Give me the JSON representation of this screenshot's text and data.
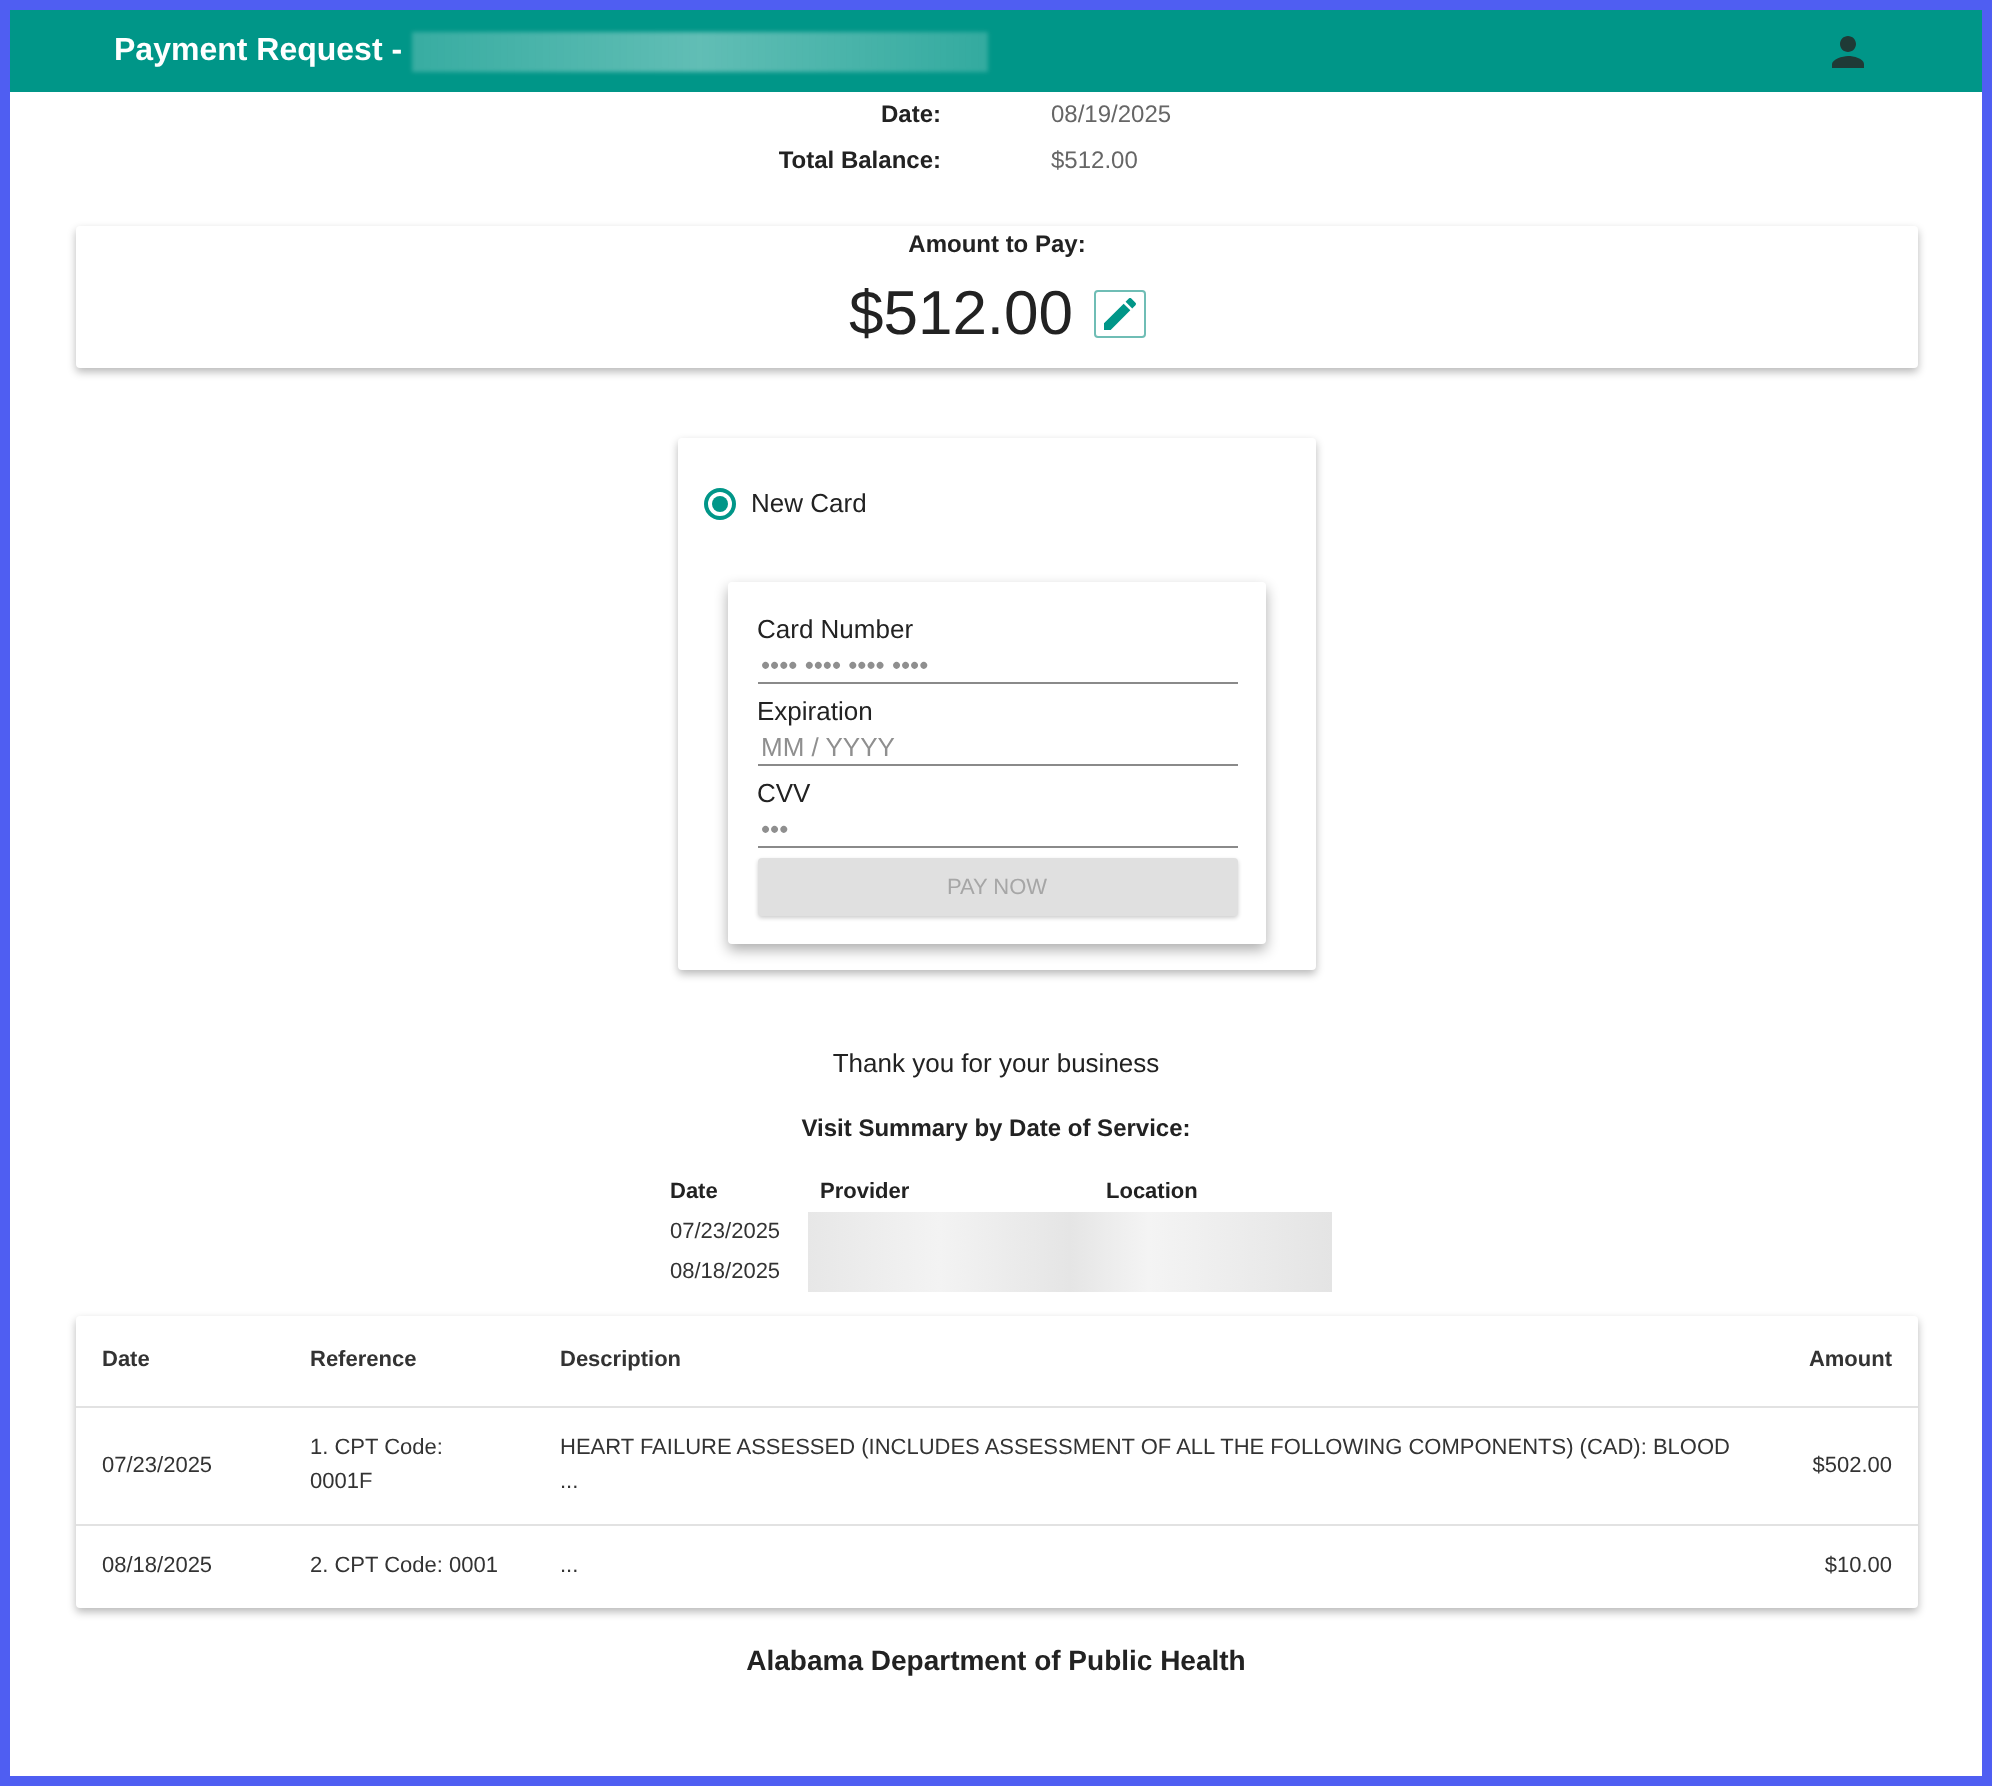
{
  "header": {
    "title": "Payment Request -"
  },
  "summary": [
    {
      "label": "Date:",
      "value": "08/19/2025"
    },
    {
      "label": "Total Balance:",
      "value": "$512.00"
    }
  ],
  "amount_card": {
    "label": "Amount to Pay:",
    "amount": "$512.00"
  },
  "payment": {
    "options": [
      {
        "label": "New Card",
        "selected": true
      }
    ],
    "fields": [
      {
        "label": "Card Number",
        "placeholder": "•••• •••• •••• ••••"
      },
      {
        "label": "Expiration",
        "placeholder": "MM / YYYY"
      },
      {
        "label": "CVV",
        "placeholder": "•••"
      }
    ],
    "pay_button": {
      "label": "PAY NOW",
      "disabled": true
    }
  },
  "thank_you": "Thank you for your business",
  "visit_summary": {
    "title": "Visit Summary by Date of Service:",
    "columns": [
      "Date",
      "Provider",
      "Location"
    ],
    "rows": [
      {
        "date": "07/23/2025"
      },
      {
        "date": "08/18/2025"
      }
    ]
  },
  "charges": {
    "columns": [
      "Date",
      "Reference",
      "Description",
      "Amount"
    ],
    "rows": [
      {
        "date": "07/23/2025",
        "reference": "1. CPT Code: 0001F",
        "description": "HEART FAILURE ASSESSED (INCLUDES ASSESSMENT OF ALL THE FOLLOWING COMPONENTS) (CAD): BLOOD\n...",
        "amount": "$502.00"
      },
      {
        "date": "08/18/2025",
        "reference": "2. CPT Code: 0001",
        "description": "...",
        "amount": "$10.00"
      }
    ]
  },
  "footer": "Alabama Department of Public Health"
}
